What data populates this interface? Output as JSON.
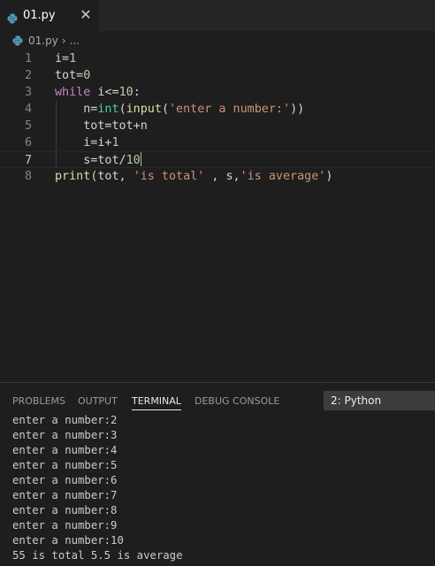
{
  "tab": {
    "title": "01.py",
    "close_glyph": "✕",
    "icon": "python-icon"
  },
  "breadcrumb": {
    "file": "01.py",
    "separator": "›",
    "more": "..."
  },
  "editor": {
    "line_numbers": [
      "1",
      "2",
      "3",
      "4",
      "5",
      "6",
      "7",
      "8"
    ],
    "lines": [
      [
        {
          "t": "i=",
          "c": ""
        },
        {
          "t": "1",
          "c": "num"
        }
      ],
      [
        {
          "t": "tot=",
          "c": ""
        },
        {
          "t": "0",
          "c": "num"
        }
      ],
      [
        {
          "t": "while",
          "c": "kw"
        },
        {
          "t": " i<=",
          "c": ""
        },
        {
          "t": "10",
          "c": "num"
        },
        {
          "t": ":",
          "c": ""
        }
      ],
      [
        {
          "t": "    n=",
          "c": ""
        },
        {
          "t": "int",
          "c": "bi"
        },
        {
          "t": "(",
          "c": ""
        },
        {
          "t": "input",
          "c": "fn"
        },
        {
          "t": "(",
          "c": ""
        },
        {
          "t": "'enter a number:'",
          "c": "str"
        },
        {
          "t": "))",
          "c": ""
        }
      ],
      [
        {
          "t": "    tot=tot+n",
          "c": ""
        }
      ],
      [
        {
          "t": "    i=i+",
          "c": ""
        },
        {
          "t": "1",
          "c": "num"
        }
      ],
      [
        {
          "t": "    s=tot/",
          "c": ""
        },
        {
          "t": "10",
          "c": "num"
        }
      ],
      [
        {
          "t": "print",
          "c": "fn"
        },
        {
          "t": "(tot, ",
          "c": ""
        },
        {
          "t": "'is total'",
          "c": "str"
        },
        {
          "t": " , s,",
          "c": ""
        },
        {
          "t": "'is average'",
          "c": "str"
        },
        {
          "t": ")",
          "c": ""
        }
      ]
    ],
    "active_line": 7
  },
  "panel": {
    "tabs": [
      "PROBLEMS",
      "OUTPUT",
      "TERMINAL",
      "DEBUG CONSOLE"
    ],
    "active_tab": "TERMINAL",
    "terminal_select": "2: Python",
    "terminal_lines": [
      "enter a number:2",
      "enter a number:3",
      "enter a number:4",
      "enter a number:5",
      "enter a number:6",
      "enter a number:7",
      "enter a number:8",
      "enter a number:9",
      "enter a number:10",
      "55 is total 5.5 is average"
    ]
  },
  "colors": {
    "editor_bg": "#1e1e1e",
    "keyword": "#c586c0",
    "number": "#b5cea8",
    "function": "#dcdcaa",
    "builtin_type": "#4ec9b0",
    "string": "#ce9178"
  }
}
